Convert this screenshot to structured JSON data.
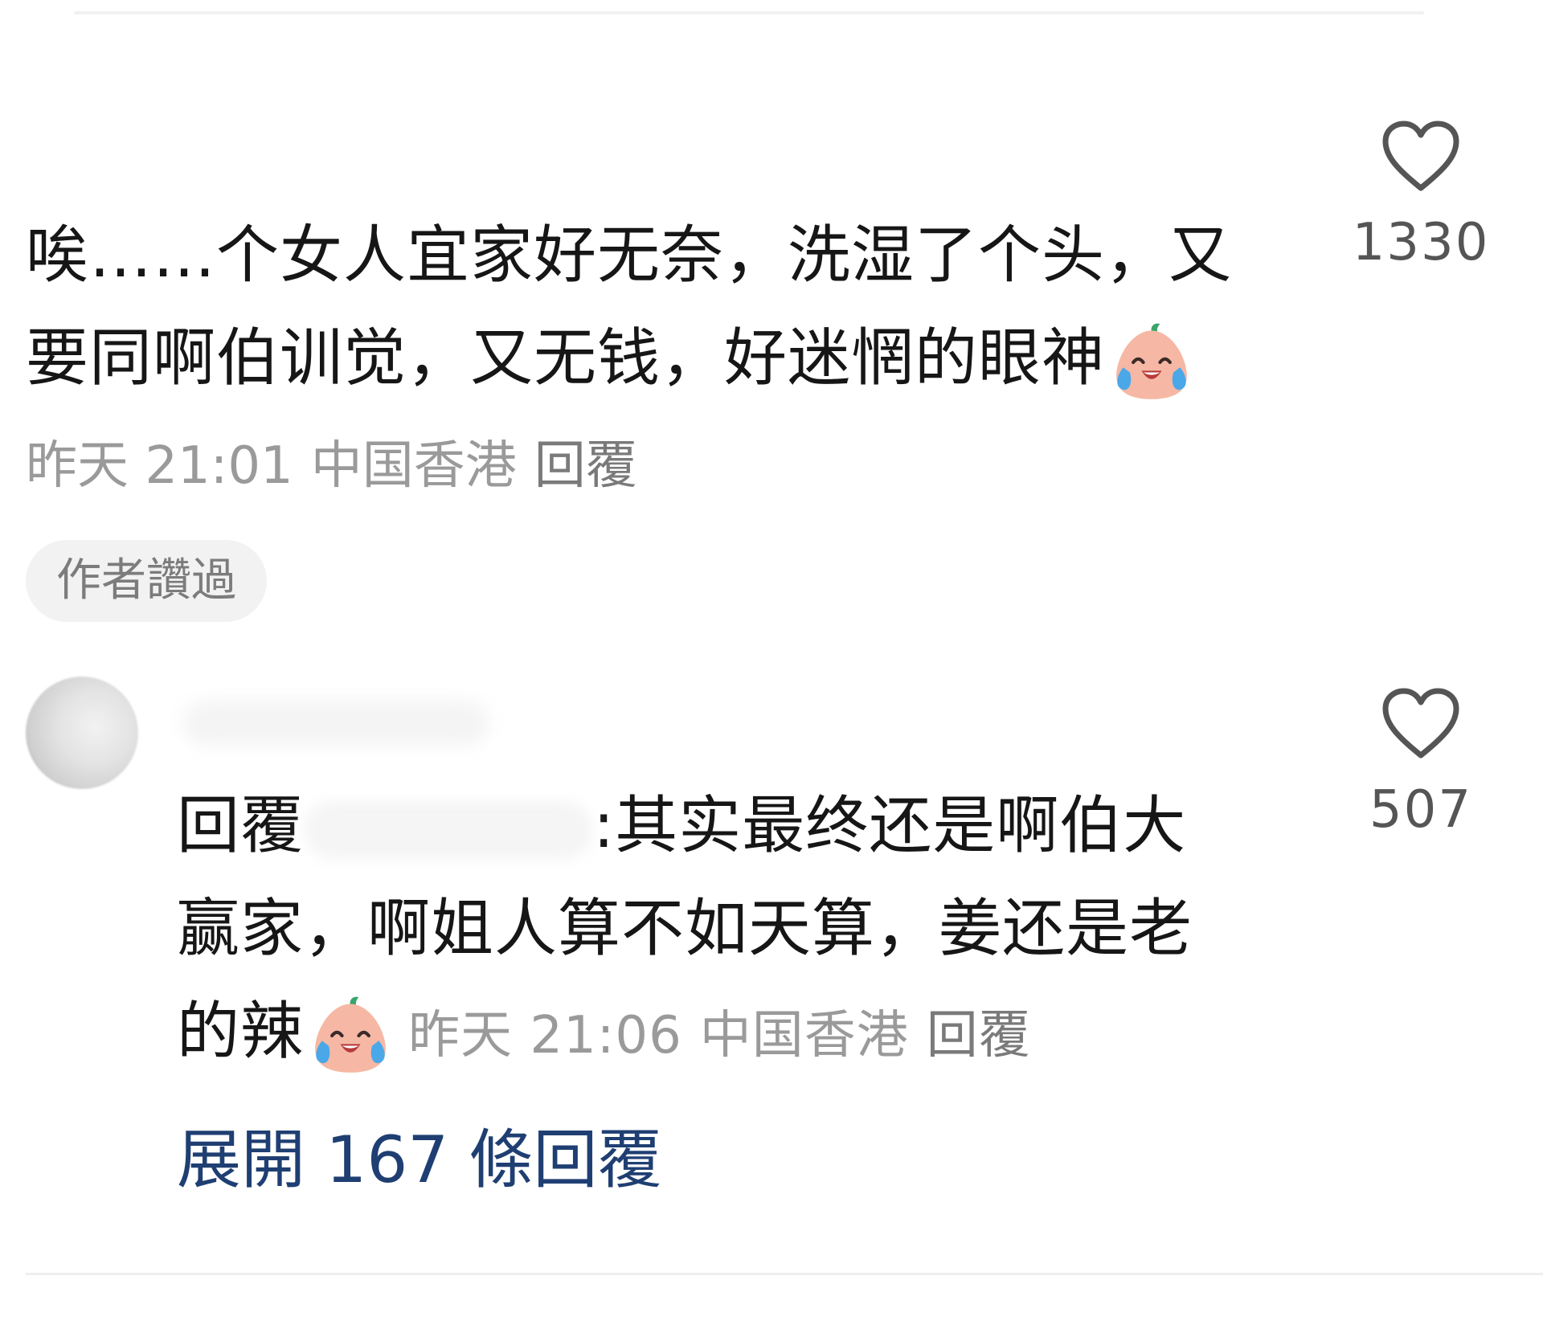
{
  "comments": [
    {
      "text_line1": "唉……个女人宜家好无奈，洗湿了个头，又",
      "text_line2": "要同啊伯训觉，又无钱，好迷惘的眼神",
      "emoji": "crying-laughing-peach-icon",
      "time": "昨天 21:01",
      "location": "中国香港",
      "reply_label": "回覆",
      "like_count": "1330",
      "badge": "作者讚過"
    },
    {
      "reply_prefix": "回覆",
      "mention_suffix": ":",
      "text_line1": "其实最终还是啊伯大",
      "text_line2": "赢家，啊姐人算不如天算，姜还是老",
      "text_line3": "的辣",
      "emoji": "crying-laughing-peach-icon",
      "time": "昨天 21:06",
      "location": "中国香港",
      "reply_label": "回覆",
      "like_count": "507",
      "expand_label": "展開 167 條回覆"
    }
  ],
  "colors": {
    "text": "#161616",
    "meta": "#9a9a9a",
    "link": "#1f3f73",
    "badge_bg": "#f2f2f2"
  }
}
